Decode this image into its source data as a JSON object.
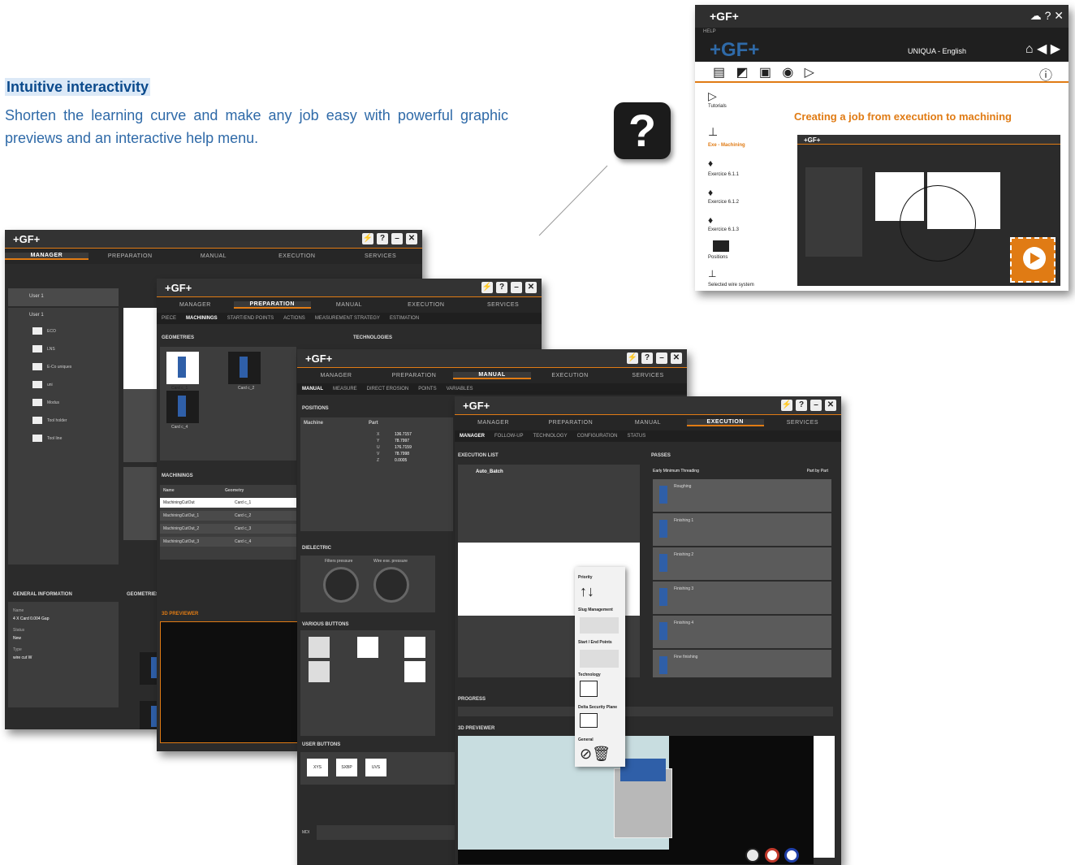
{
  "heading": "Intuitive interactivity",
  "description": "Shorten the learning curve and make any job easy with powerful graphic previews and an interactive help menu.",
  "help_icon": "question-mark-icon",
  "help_window": {
    "label": "HELP",
    "logo": "+GF+",
    "language": "UNIQUA - English",
    "headline": "Creating a job from execution to machining",
    "nav": [
      "Tutorials",
      "Exe - Machining",
      "Exercice 6.1.1",
      "Exercice 6.1.2",
      "Exercice 6.1.3",
      "Positions",
      "Selected wire system"
    ]
  },
  "app": {
    "logo": "+GF+",
    "tabs": [
      "MANAGER",
      "PREPARATION",
      "MANUAL",
      "EXECUTION",
      "SERVICES"
    ]
  },
  "manager_window": {
    "user": "User 1",
    "tree": [
      "User 1",
      "ECO",
      "LNS",
      "E-Co uniques",
      "uni",
      "Modus",
      "Tool holder",
      "Tool line"
    ],
    "general_info_label": "GENERAL INFORMATION",
    "geometries_label": "GEOMETRIES",
    "info": [
      "Name",
      "4 X Card 0.004 Gap",
      "Status",
      "New",
      "Type",
      "wire cut W"
    ]
  },
  "preparation_window": {
    "subtabs": [
      "PIECE",
      "MACHININGS",
      "START/END POINTS",
      "ACTIONS",
      "MEASUREMENT STRATEGY",
      "ESTIMATION"
    ],
    "geometries_label": "GEOMETRIES",
    "technologies_label": "TECHNOLOGIES",
    "parts": [
      "Card c_1",
      "Card c_2",
      "Card c_4"
    ],
    "machinings_label": "MACHININGS",
    "columns": [
      "Name",
      "Geometry"
    ],
    "rows": [
      [
        "MachiningCutOut",
        "Card c_1"
      ],
      [
        "MachiningCutOut_1",
        "Card c_2"
      ],
      [
        "MachiningCutOut_2",
        "Card c_3"
      ],
      [
        "MachiningCutOut_3",
        "Card c_4"
      ]
    ],
    "previewer_label": "3D PREVIEWER"
  },
  "manual_window": {
    "subtabs": [
      "MANUAL",
      "MEASURE",
      "DIRECT EROSION",
      "POINTS",
      "VARIABLES"
    ],
    "positions_label": "POSITIONS",
    "columns": [
      "Machine",
      "Part"
    ],
    "axes": [
      "X",
      "Y",
      "U",
      "V",
      "Z"
    ],
    "values": [
      "136.7157",
      "78.7997",
      "176.7159",
      "78.7998",
      "0.0005"
    ],
    "dielectric_label": "DIELECTRIC",
    "filters_label": "Filters pressure",
    "wire_label": "Wire exe. pressure",
    "various_label": "VARIOUS BUTTONS",
    "user_buttons_label": "USER BUTTONS",
    "user_buttons": [
      "XYS",
      "SXBP",
      "UVS"
    ],
    "mdi_label": "MDI"
  },
  "execution_window": {
    "subtabs": [
      "MANAGER",
      "FOLLOW-UP",
      "TECHNOLOGY",
      "CONFIGURATION",
      "STATUS"
    ],
    "execution_list_label": "EXECUTION LIST",
    "batch": "Auto_Batch",
    "passes_label": "PASSES",
    "pass_mode": "Early Minimum Threading",
    "part_by_part": "Part by Part",
    "passes": [
      "Roughing",
      "Finishing 1",
      "Finishing 2",
      "Finishing 3",
      "Finishing 4",
      "Fine finishing",
      "Roughing"
    ],
    "context_menu": [
      "Priority",
      "Slug Management",
      "Start / End Points",
      "Technology",
      "Delta Security Plane",
      "General"
    ],
    "progress_label": "PROGRESS",
    "previewer_label": "3D PREVIEWER"
  },
  "colors": {
    "accent": "#e07b14",
    "heading_text": "#0b4a8c",
    "body_text": "#2f6aa8",
    "heading_bg": "#dce9f7",
    "play": "#e8e8e8",
    "pause": "#c0392b",
    "stop": "#1f3fa8"
  }
}
